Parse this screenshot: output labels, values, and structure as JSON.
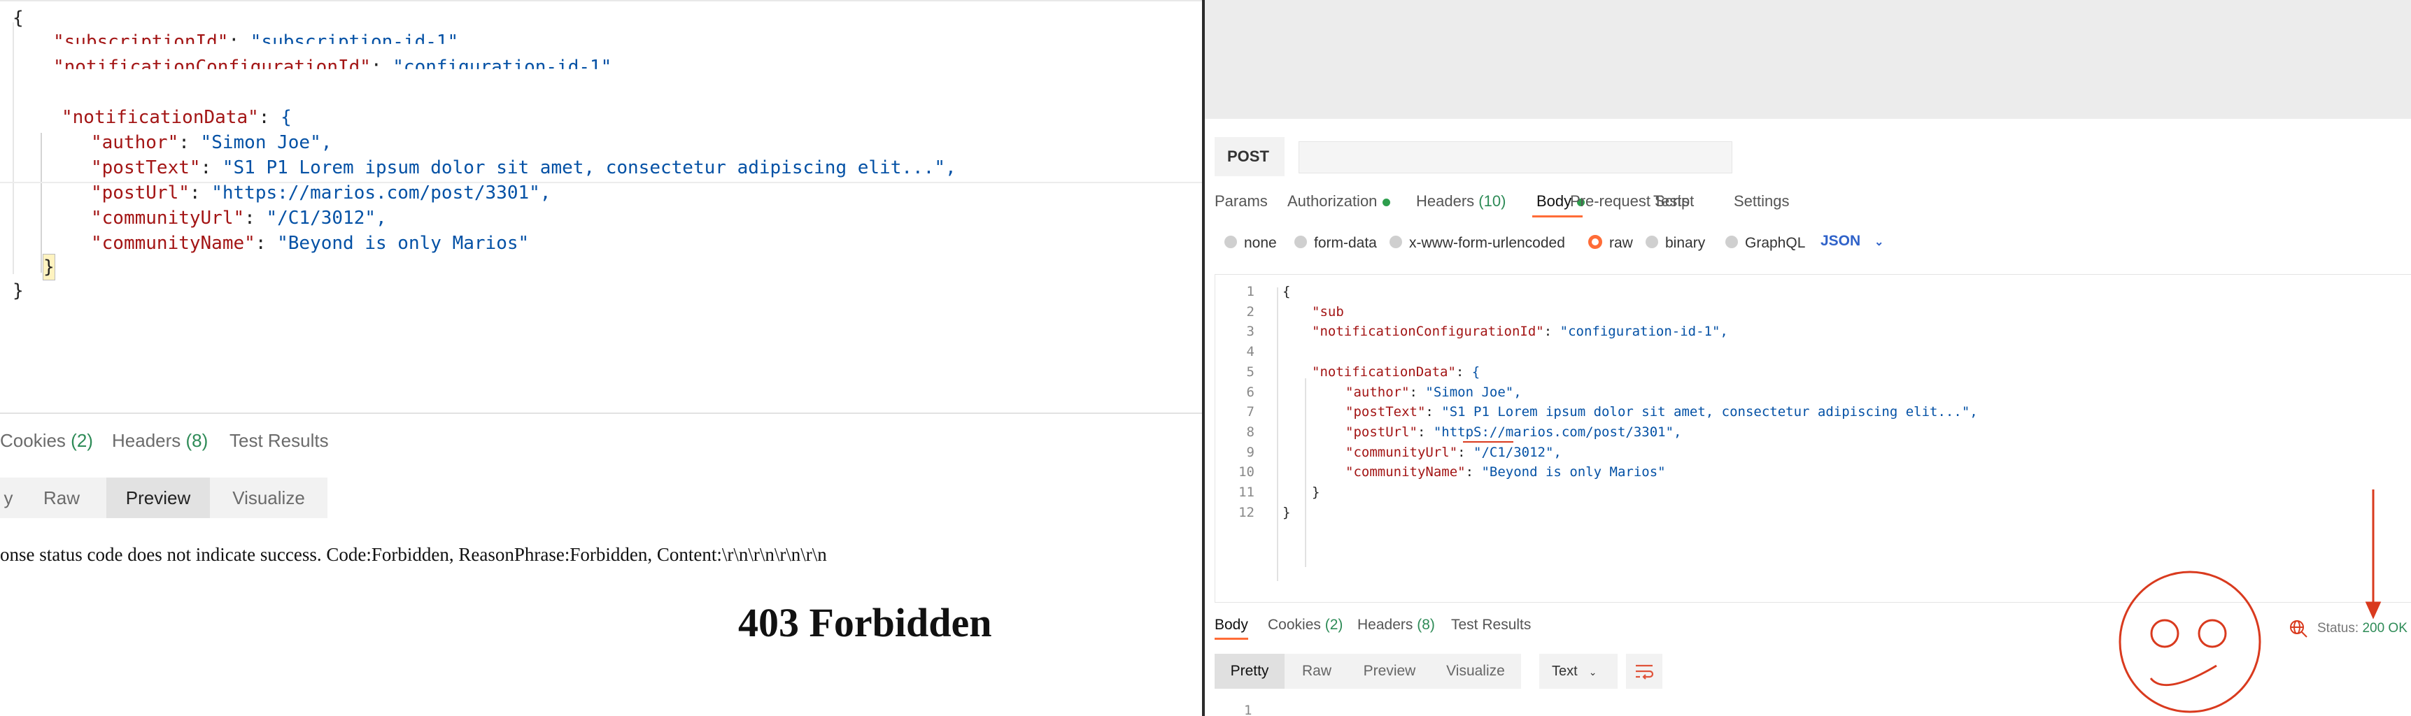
{
  "left": {
    "code_lines": [
      {
        "k": "\"subscriptionId\"",
        "sep": ": ",
        "v": "\"subscription-id-1\",",
        "indent": 1,
        "garbled": true
      },
      {
        "k": "\"notificationConfigurationId\"",
        "sep": ": ",
        "v": "\"configuration-id-1\",",
        "indent": 1,
        "garbled": true
      },
      {
        "k": "\"notificationData\"",
        "sep": ": ",
        "v": "{",
        "indent": 1
      },
      {
        "k": "\"author\"",
        "sep": ": ",
        "v": "\"Simon Joe\",",
        "indent": 2
      },
      {
        "k": "\"postText\"",
        "sep": ": ",
        "v": "\"S1 P1 Lorem ipsum dolor sit amet, consectetur adipiscing elit...\",",
        "indent": 2
      },
      {
        "k": "\"postUrl\"",
        "sep": ": ",
        "v": "\"https://marios.com/post/3301\",",
        "indent": 2
      },
      {
        "k": "\"communityUrl\"",
        "sep": ": ",
        "v": "\"/C1/3012\",",
        "indent": 2
      },
      {
        "k": "\"communityName\"",
        "sep": ": ",
        "v": "\"Beyond is only Marios\"",
        "indent": 2
      }
    ],
    "open_brace": "{",
    "close_inner": "}",
    "close_outer": "}",
    "tabs": {
      "cookies": "Cookies",
      "cookies_count": "(2)",
      "headers": "Headers",
      "headers_count": "(8)",
      "tests": "Test Results"
    },
    "view_buttons": {
      "pretty_partial": "y",
      "raw": "Raw",
      "preview": "Preview",
      "visualize": "Visualize"
    },
    "error_text": "onse status code does not indicate success. Code:Forbidden, ReasonPhrase:Forbidden, Content:\\r\\n\\r\\n\\r\\n\\r\\n",
    "heading": "403 Forbidden"
  },
  "right": {
    "method": "POST",
    "tabs": [
      {
        "label": "Params"
      },
      {
        "label": "Authorization",
        "dot": true
      },
      {
        "label": "Headers",
        "count": "(10)"
      },
      {
        "label": "Body",
        "dot": true,
        "active": true
      },
      {
        "label": "Pre-request Script"
      },
      {
        "label": "Tests"
      },
      {
        "label": "Settings"
      }
    ],
    "body_types": [
      {
        "label": "none"
      },
      {
        "label": "form-data"
      },
      {
        "label": "x-www-form-urlencoded"
      },
      {
        "label": "raw",
        "selected": true
      },
      {
        "label": "binary"
      },
      {
        "label": "GraphQL"
      }
    ],
    "format": "JSON",
    "editor_lines": [
      {
        "n": "1",
        "text": "{"
      },
      {
        "n": "2",
        "k": "\"sub",
        "v": "",
        "garbled": true
      },
      {
        "n": "3",
        "k": "\"notificationConfigurationId\"",
        "sep": ": ",
        "v": "\"configuration-id-1\","
      },
      {
        "n": "4",
        "text": ""
      },
      {
        "n": "5",
        "k": "\"notificationData\"",
        "sep": ": ",
        "v": "{"
      },
      {
        "n": "6",
        "k": "\"author\"",
        "sep": ": ",
        "v": "\"Simon Joe\",",
        "indent": 2
      },
      {
        "n": "7",
        "k": "\"postText\"",
        "sep": ": ",
        "v": "\"S1 P1 Lorem ipsum dolor sit amet, consectetur adipiscing elit...\",",
        "indent": 2
      },
      {
        "n": "8",
        "k": "\"postUrl\"",
        "sep": ": ",
        "v": "\"httpS://marios.com/post/3301\",",
        "indent": 2
      },
      {
        "n": "9",
        "k": "\"communityUrl\"",
        "sep": ": ",
        "v": "\"/C1/3012\",",
        "indent": 2
      },
      {
        "n": "10",
        "k": "\"communityName\"",
        "sep": ": ",
        "v": "\"Beyond is only Marios\"",
        "indent": 2
      },
      {
        "n": "11",
        "text": "}"
      },
      {
        "n": "12",
        "text": "}"
      }
    ],
    "response_tabs": {
      "body": "Body",
      "cookies": "Cookies",
      "cookies_count": "(2)",
      "headers": "Headers",
      "headers_count": "(8)",
      "tests": "Test Results"
    },
    "response_view": {
      "pretty": "Pretty",
      "raw": "Raw",
      "preview": "Preview",
      "visualize": "Visualize",
      "text_format": "Text"
    },
    "status_label": "Status:",
    "status_value": "200 OK",
    "last_line_number": "1",
    "colors": {
      "accent": "#ff6c37",
      "ok": "#2e8b57",
      "annotation": "#d93a1e"
    }
  }
}
